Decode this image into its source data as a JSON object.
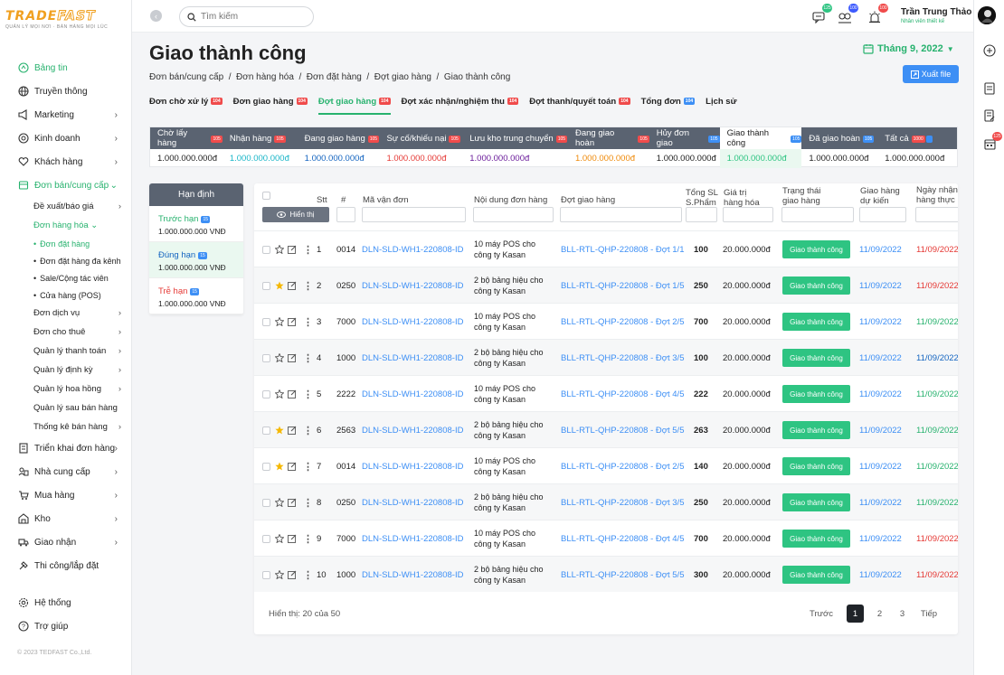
{
  "brand": {
    "name_part1": "TRADE",
    "name_part2": "FAST",
    "tagline": "QUẢN LÝ MỌI NƠI · BÁN HÀNG MỌI LÚC"
  },
  "sidebar": {
    "items": [
      {
        "label": "Bảng tin",
        "icon": "dashboard-icon",
        "active": true
      },
      {
        "label": "Truyền thông",
        "icon": "globe-icon"
      },
      {
        "label": "Marketing",
        "icon": "megaphone-icon",
        "chevron": true
      },
      {
        "label": "Kinh doanh",
        "icon": "target-icon",
        "chevron": true
      },
      {
        "label": "Khách hàng",
        "icon": "heart-icon",
        "chevron": true
      }
    ],
    "sales": {
      "label": "Đơn bán/cung cấp",
      "icon": "cart-box-icon"
    },
    "sales_sub": [
      {
        "label": "Đề xuất/báo giá",
        "chevron": true
      },
      {
        "label": "Đơn hàng hóa ⌄",
        "green": true
      }
    ],
    "sales_sub2": [
      {
        "label": "Đơn đặt hàng",
        "green": true
      },
      {
        "label": "Đơn đặt hàng đa kênh"
      },
      {
        "label": "Sale/Cộng tác viên"
      },
      {
        "label": "Cửa hàng (POS)"
      }
    ],
    "sales_sub3": [
      {
        "label": "Đơn dịch vụ",
        "chevron": true
      },
      {
        "label": "Đơn cho thuê",
        "chevron": true
      },
      {
        "label": "Quản lý thanh toán",
        "chevron": true
      },
      {
        "label": "Quản lý định kỳ",
        "chevron": true
      },
      {
        "label": "Quản lý hoa hồng",
        "chevron": true
      },
      {
        "label": "Quản lý sau bán hàng"
      },
      {
        "label": "Thống kê bán hàng",
        "chevron": true
      }
    ],
    "items2": [
      {
        "label": "Triển khai đơn hàng",
        "icon": "building-icon",
        "chevron": true
      },
      {
        "label": "Nhà cung cấp",
        "icon": "supplier-icon",
        "chevron": true
      },
      {
        "label": "Mua hàng",
        "icon": "cart-icon",
        "chevron": true
      },
      {
        "label": "Kho",
        "icon": "warehouse-icon",
        "chevron": true
      },
      {
        "label": "Giao nhận",
        "icon": "truck-icon",
        "chevron": true
      },
      {
        "label": "Thi công/lắp đặt",
        "icon": "tools-icon"
      }
    ],
    "bottom": [
      {
        "label": "Hệ thống",
        "icon": "gear-icon"
      },
      {
        "label": "Trợ giúp",
        "icon": "help-icon"
      }
    ],
    "copyright": "© 2023 TEDFAST Co.,Ltd."
  },
  "topbar": {
    "search_placeholder": "Tìm kiếm",
    "badges": [
      "125",
      "100",
      "100"
    ],
    "user_name": "Trần Trung Thảo",
    "user_role": "Nhân viên thiết kế"
  },
  "header": {
    "title": "Giao thành công",
    "breadcrumb": "Đơn bán/cung cấp  /  Đơn hàng hóa  /  Đơn đặt hàng  /  Đợt giao hàng  /  Giao thành công",
    "month": "Tháng 9, 2022",
    "export_label": "Xuất file"
  },
  "tabs": [
    {
      "label": "Đơn chờ xử lý",
      "badge": "104",
      "color": "red"
    },
    {
      "label": "Đơn giao hàng",
      "badge": "104",
      "color": "red"
    },
    {
      "label": "Đợt giao hàng",
      "badge": "104",
      "color": "red",
      "active": true
    },
    {
      "label": "Đợt xác nhận/nghiệm thu",
      "badge": "104",
      "color": "red"
    },
    {
      "label": "Đợt thanh/quyết toán",
      "badge": "104",
      "color": "red"
    },
    {
      "label": "Tổng đơn",
      "badge": "104",
      "color": "blue"
    },
    {
      "label": "Lịch sử",
      "badge": "",
      "color": ""
    }
  ],
  "status_tabs": [
    {
      "label": "Chờ lấy hàng",
      "badge": "105",
      "value": "1.000.000.000đ",
      "vcolor": "#222",
      "w": 80
    },
    {
      "label": "Nhận hàng",
      "badge": "105",
      "value": "1.000.000.000đ",
      "vcolor": "#1ab6c8",
      "w": 83
    },
    {
      "label": "Đang giao hàng",
      "badge": "105",
      "value": "1.000.000.000đ",
      "vcolor": "#1565c0",
      "w": 91
    },
    {
      "label": "Sự cố/khiếu nại",
      "badge": "105",
      "value": "1.000.000.000đ",
      "vcolor": "#e53935",
      "w": 92
    },
    {
      "label": "Lưu kho trung chuyển",
      "badge": "105",
      "value": "1.000.000.000đ",
      "vcolor": "#6a1b9a",
      "w": 117
    },
    {
      "label": "Đang giao hoàn",
      "badge": "105",
      "value": "1.000.000.000đ",
      "vcolor": "#ef8a0a",
      "w": 90
    },
    {
      "label": "Hủy đơn giao",
      "badge": "105",
      "value": "1.000.000.000đ",
      "vcolor": "#222",
      "w": 78,
      "blue": true
    },
    {
      "label": "Giao thành công",
      "badge": "105",
      "value": "1.000.000.000đ",
      "vcolor": "#2ec482",
      "w": 91,
      "blue": true,
      "sel": true
    },
    {
      "label": "Đã giao hoàn",
      "badge": "105",
      "value": "1.000.000.000đ",
      "vcolor": "#222",
      "w": 84,
      "blue": true
    },
    {
      "label": "Tất cả",
      "badge": "1000",
      "value": "1.000.000.000đ",
      "vcolor": "#222",
      "w": 88,
      "mixed": true
    }
  ],
  "limit": {
    "title": "Hạn định",
    "items": [
      {
        "label": "Trước hạn",
        "badge": "15",
        "value": "1.000.000.000 VNĐ",
        "color": "#27b26e"
      },
      {
        "label": "Đúng hạn",
        "badge": "15",
        "value": "1.000.000.000 VNĐ",
        "color": "#1565c0",
        "sel": true
      },
      {
        "label": "Trễ hạn",
        "badge": "15",
        "value": "1.000.000.000 VNĐ",
        "color": "#e53935"
      }
    ]
  },
  "table": {
    "show_label": "Hiển thị",
    "headers": {
      "stt": "Stt",
      "num": "#",
      "code": "Mã vận đơn",
      "content": "Nội dung đơn hàng",
      "batch": "Đợt giao hàng",
      "qty": "Tổng SL S.Phẩm",
      "value": "Giá trị hàng hóa",
      "status": "Trạng thái giao hàng",
      "expected": "Giao hàng dự kiến",
      "actual": "Ngày nhận hàng thực"
    },
    "rows": [
      {
        "stt": "1",
        "num": "0014",
        "code": "DLN-SLD-WH1-220808-ID",
        "content": "10 máy POS cho công ty Kasan",
        "batch": "BLL-RTL-QHP-220808 - Đợt 1/1",
        "qty": "100",
        "value": "20.000.000đ",
        "status": "Giao thành công",
        "expected": "11/09/2022",
        "actual": "11/09/2022",
        "actual_color": "#e53935",
        "star": false
      },
      {
        "stt": "2",
        "num": "0250",
        "code": "DLN-SLD-WH1-220808-ID",
        "content": "2 bộ bảng hiệu cho công ty Kasan",
        "batch": "BLL-RTL-QHP-220808 - Đợt 1/5",
        "qty": "250",
        "value": "20.000.000đ",
        "status": "Giao thành công",
        "expected": "11/09/2022",
        "actual": "11/09/2022",
        "actual_color": "#e53935",
        "star": true
      },
      {
        "stt": "3",
        "num": "7000",
        "code": "DLN-SLD-WH1-220808-ID",
        "content": "10 máy POS cho công ty Kasan",
        "batch": "BLL-RTL-QHP-220808 - Đợt 2/5",
        "qty": "700",
        "value": "20.000.000đ",
        "status": "Giao thành công",
        "expected": "11/09/2022",
        "actual": "11/09/2022",
        "actual_color": "#27b26e",
        "star": false
      },
      {
        "stt": "4",
        "num": "1000",
        "code": "DLN-SLD-WH1-220808-ID",
        "content": "2 bộ bảng hiệu cho công ty Kasan",
        "batch": "BLL-RTL-QHP-220808 - Đợt 3/5",
        "qty": "100",
        "value": "20.000.000đ",
        "status": "Giao thành công",
        "expected": "11/09/2022",
        "actual": "11/09/2022",
        "actual_color": "#1565c0",
        "star": false
      },
      {
        "stt": "5",
        "num": "2222",
        "code": "DLN-SLD-WH1-220808-ID",
        "content": "10 máy POS cho công ty Kasan",
        "batch": "BLL-RTL-QHP-220808 - Đợt 4/5",
        "qty": "222",
        "value": "20.000.000đ",
        "status": "Giao thành công",
        "expected": "11/09/2022",
        "actual": "11/09/2022",
        "actual_color": "#27b26e",
        "star": false
      },
      {
        "stt": "6",
        "num": "2563",
        "code": "DLN-SLD-WH1-220808-ID",
        "content": "2 bộ bảng hiệu cho công ty Kasan",
        "batch": "BLL-RTL-QHP-220808 - Đợt 5/5",
        "qty": "263",
        "value": "20.000.000đ",
        "status": "Giao thành công",
        "expected": "11/09/2022",
        "actual": "11/09/2022",
        "actual_color": "#27b26e",
        "star": true
      },
      {
        "stt": "7",
        "num": "0014",
        "code": "DLN-SLD-WH1-220808-ID",
        "content": "10 máy POS cho công ty Kasan",
        "batch": "BLL-RTL-QHP-220808 - Đợt 2/5",
        "qty": "140",
        "value": "20.000.000đ",
        "status": "Giao thành công",
        "expected": "11/09/2022",
        "actual": "11/09/2022",
        "actual_color": "#27b26e",
        "star": true
      },
      {
        "stt": "8",
        "num": "0250",
        "code": "DLN-SLD-WH1-220808-ID",
        "content": "2 bộ bảng hiệu cho công ty Kasan",
        "batch": "BLL-RTL-QHP-220808 - Đợt 3/5",
        "qty": "250",
        "value": "20.000.000đ",
        "status": "Giao thành công",
        "expected": "11/09/2022",
        "actual": "11/09/2022",
        "actual_color": "#27b26e",
        "star": false
      },
      {
        "stt": "9",
        "num": "7000",
        "code": "DLN-SLD-WH1-220808-ID",
        "content": "10 máy POS cho công ty Kasan",
        "batch": "BLL-RTL-QHP-220808 - Đợt 4/5",
        "qty": "700",
        "value": "20.000.000đ",
        "status": "Giao thành công",
        "expected": "11/09/2022",
        "actual": "11/09/2022",
        "actual_color": "#e53935",
        "star": false
      },
      {
        "stt": "10",
        "num": "1000",
        "code": "DLN-SLD-WH1-220808-ID",
        "content": "2 bộ bảng hiệu cho công ty Kasan",
        "batch": "BLL-RTL-QHP-220808 - Đợt 5/5",
        "qty": "300",
        "value": "20.000.000đ",
        "status": "Giao thành công",
        "expected": "11/09/2022",
        "actual": "11/09/2022",
        "actual_color": "#e53935",
        "star": false
      }
    ],
    "footer": "Hiển thị: 20 của 50",
    "pager": {
      "prev": "Trước",
      "pages": [
        "1",
        "2",
        "3"
      ],
      "next": "Tiếp"
    }
  },
  "colors": {
    "accent": "#27b26e",
    "primary": "#3d8ff5",
    "header_dark": "#5a6371",
    "danger": "#f04b4b"
  }
}
